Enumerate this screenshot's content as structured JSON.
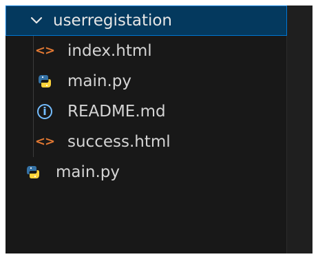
{
  "explorer": {
    "folder": {
      "name": "userregistation",
      "expanded": true,
      "icon": "chevron-down-icon"
    },
    "children": [
      {
        "name": "index.html",
        "icon": "html-file-icon",
        "glyph": "<>"
      },
      {
        "name": "main.py",
        "icon": "python-file-icon"
      },
      {
        "name": "README.md",
        "icon": "info-icon",
        "glyph": "i"
      },
      {
        "name": "success.html",
        "icon": "html-file-icon",
        "glyph": "<>"
      }
    ],
    "root_files": [
      {
        "name": "main.py",
        "icon": "python-file-icon"
      }
    ],
    "colors": {
      "selected_background": "#04395e",
      "selected_border": "#0078d4",
      "html_icon": "#e37933",
      "python_blue": "#3572a5",
      "python_yellow": "#ffd43b",
      "info_icon": "#75beff"
    }
  }
}
